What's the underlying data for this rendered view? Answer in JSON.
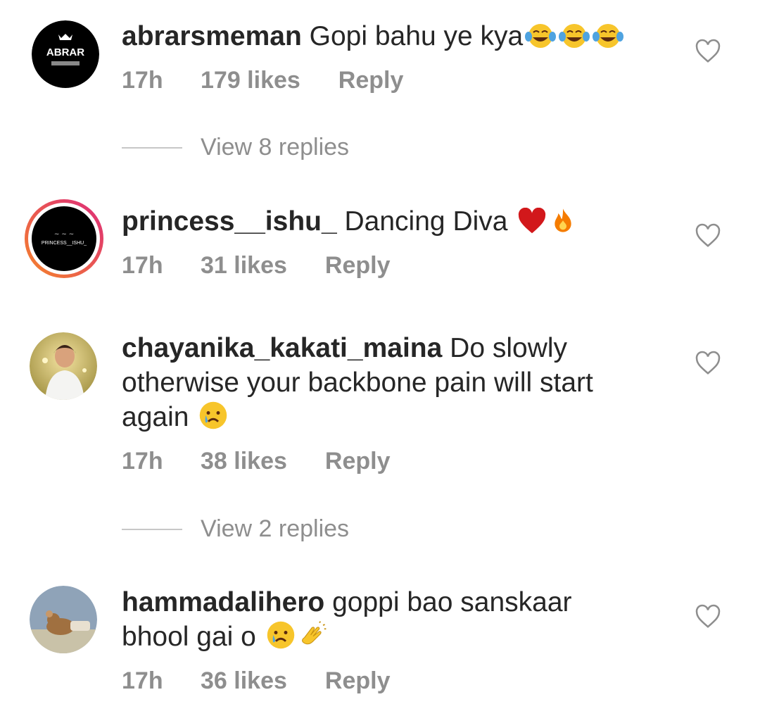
{
  "comments": [
    {
      "username": "abrarsmeman",
      "text": "Gopi bahu ye kya",
      "avatar_text": "ABRAR",
      "time": "17h",
      "likes": "179 likes",
      "reply": "Reply",
      "emojis": [
        "joy-emoji",
        "joy-emoji",
        "joy-emoji"
      ]
    },
    {
      "username": "princess__ishu_",
      "text": "Dancing Diva",
      "avatar_text": "PRINCESS__ISHU_",
      "time": "17h",
      "likes": "31 likes",
      "reply": "Reply",
      "emojis": [
        "red-heart-emoji",
        "fire-emoji"
      ]
    },
    {
      "username": "chayanika_kakati_maina",
      "text": "Do slowly otherwise your backbone pain will start again",
      "time": "17h",
      "likes": "38 likes",
      "reply": "Reply",
      "emojis": [
        "crying-emoji"
      ]
    },
    {
      "username": "hammadalihero",
      "text": "goppi bao sanskaar bhool gai o",
      "time": "17h",
      "likes": "36 likes",
      "reply": "Reply",
      "emojis": [
        "crying-emoji",
        "clapping-hands-emoji"
      ]
    }
  ],
  "view_replies": [
    "View 8 replies",
    "View 2 replies"
  ],
  "colors": {
    "text": "#262626",
    "meta": "#8e8e8e",
    "divider": "#c7c7c7",
    "story_ring_start": "#f58529",
    "story_ring_end": "#dd2a7b"
  }
}
